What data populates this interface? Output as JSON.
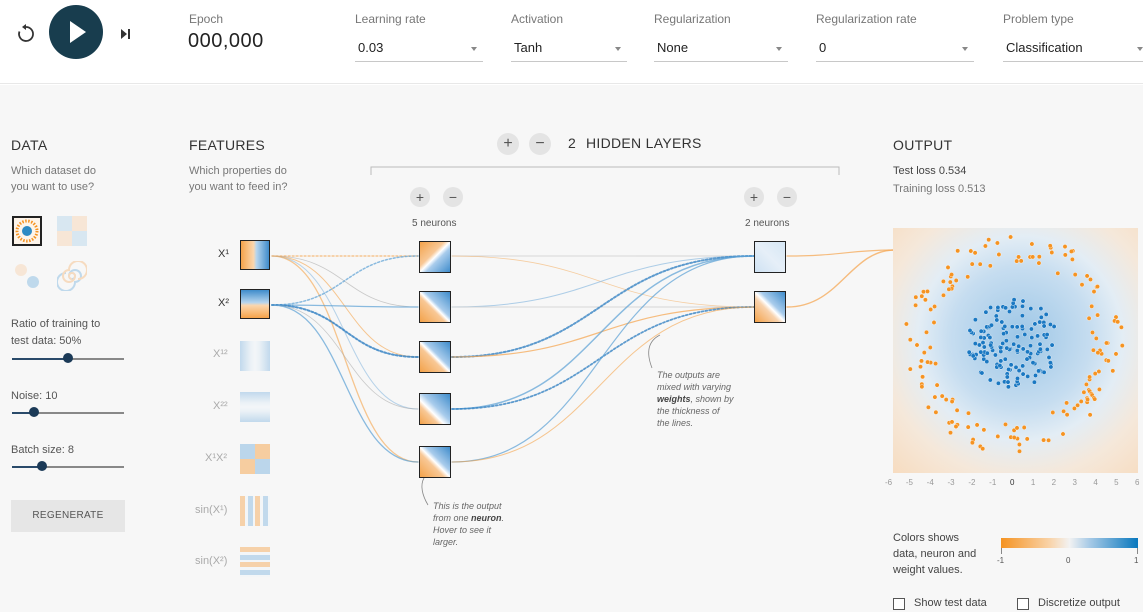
{
  "controls": {
    "epoch_label": "Epoch",
    "epoch_value": "000,000",
    "learning_rate_label": "Learning rate",
    "learning_rate_value": "0.03",
    "activation_label": "Activation",
    "activation_value": "Tanh",
    "regularization_label": "Regularization",
    "regularization_value": "None",
    "regularization_rate_label": "Regularization rate",
    "regularization_rate_value": "0",
    "problem_type_label": "Problem type",
    "problem_type_value": "Classification"
  },
  "icons": {
    "reset": "reset-icon",
    "play": "play-icon",
    "step": "step-icon"
  },
  "data_panel": {
    "title": "DATA",
    "subtitle_line1": "Which dataset do",
    "subtitle_line2": "you want to use?",
    "ratio_label_line1": "Ratio of training to",
    "ratio_label_line2": "test data:  50%",
    "ratio_value": 0.5,
    "noise_label": "Noise:  10",
    "noise_value": 0.2,
    "batch_label": "Batch size:  8",
    "batch_value": 0.27,
    "regenerate_label": "REGENERATE"
  },
  "features_panel": {
    "title": "FEATURES",
    "subtitle_line1": "Which properties do",
    "subtitle_line2": "you want to feed in?",
    "features": [
      {
        "label": "X¹",
        "active": true
      },
      {
        "label": "X²",
        "active": true
      },
      {
        "label": "X¹²",
        "active": false
      },
      {
        "label": "X²²",
        "active": false
      },
      {
        "label": "X¹X²",
        "active": false
      },
      {
        "label": "sin(X¹)",
        "active": false
      },
      {
        "label": "sin(X²)",
        "active": false
      }
    ]
  },
  "network": {
    "plus": "+",
    "minus": "−",
    "hidden_layers_count": "2",
    "hidden_layers_label": "HIDDEN LAYERS",
    "layer1_neurons": "5 neurons",
    "layer2_neurons": "2 neurons",
    "note_weights_line1": "The outputs are",
    "note_weights_line2": "mixed with varying",
    "note_weights_bold": "weights",
    "note_weights_line3": ", shown by",
    "note_weights_line4": "the thickness of",
    "note_weights_line5": "the lines.",
    "note_neuron_line1": "This is the output",
    "note_neuron_line2": "from one ",
    "note_neuron_bold": "neuron",
    "note_neuron_line3": "Hover to see it",
    "note_neuron_line4": "larger."
  },
  "output_panel": {
    "title": "OUTPUT",
    "test_loss": "Test loss 0.534",
    "training_loss": "Training loss 0.513",
    "x_ticks": [
      "-6",
      "-5",
      "-4",
      "-3",
      "-2",
      "-1",
      "0",
      "1",
      "2",
      "3",
      "4",
      "5",
      "6"
    ],
    "colors_line1": "Colors shows",
    "colors_line2": "data, neuron and",
    "colors_line3": "weight values.",
    "scale_min": "-1",
    "scale_mid": "0",
    "scale_max": "1",
    "show_test_data": "Show test data",
    "discretize_output": "Discretize output"
  },
  "colors": {
    "orange": "#f59322",
    "blue": "#0877bd",
    "dark_button": "#183d4e"
  }
}
